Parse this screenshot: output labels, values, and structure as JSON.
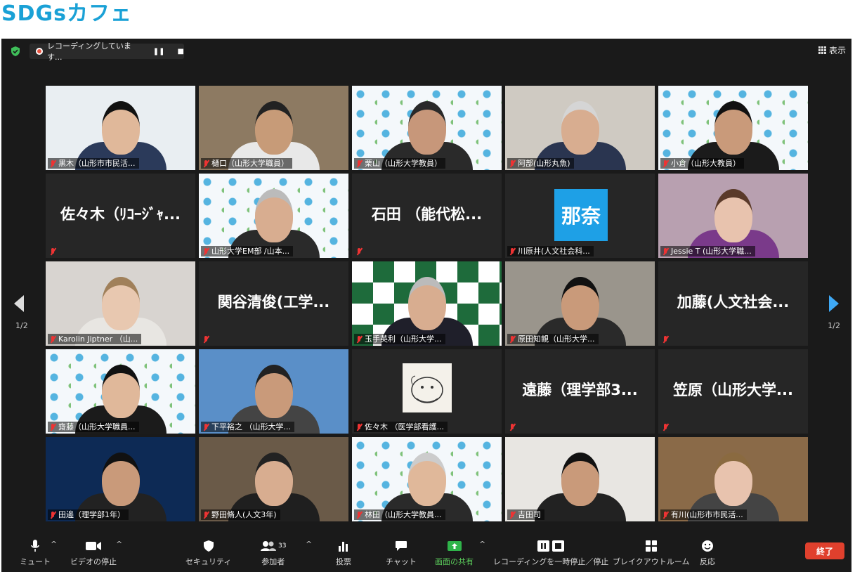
{
  "page": {
    "title": "SDGsカフェ"
  },
  "topbar": {
    "recording_text": "レコーディングしています...",
    "view_label": "表示"
  },
  "pagination": {
    "left": "1/2",
    "right": "1/2"
  },
  "participants": [
    {
      "label": "黒木（山形市市民活...",
      "video": true,
      "bg": "#e9eef2",
      "skin": "#e0b89a",
      "shirt": "#2b3a5a",
      "hair": "#111"
    },
    {
      "label": "樋口（山形大学職員）",
      "video": true,
      "bg": "#8d7a62",
      "skin": "#c79b78",
      "shirt": "#e8e8e8",
      "hair": "#222",
      "active": true
    },
    {
      "label": "栗山（山形大学教員）",
      "video": true,
      "pattern": "sdg",
      "skin": "#c7977a",
      "shirt": "#2a2a2a",
      "hair": "#2a2a2a"
    },
    {
      "label": "阿部(山形丸魚)",
      "video": true,
      "bg": "#cfcac2",
      "skin": "#d8ad90",
      "shirt": "#2a3550",
      "hair": "#d5d5d5"
    },
    {
      "label": "小倉（山形大教員）",
      "video": true,
      "pattern": "sdg",
      "skin": "#c99a7a",
      "shirt": "#1b1b1b",
      "hair": "#111"
    },
    {
      "label": "",
      "video": false,
      "name": "佐々木（ﾘｺｰｼﾞｬ..."
    },
    {
      "label": "山形大学EM部 /山本...",
      "video": true,
      "pattern": "sdg",
      "skin": "#d8ad90",
      "shirt": "#2a2a2a",
      "hair": "#bbb"
    },
    {
      "label": "",
      "video": false,
      "name": "石田 （能代松..."
    },
    {
      "label": "川原井(人文社会科...",
      "video": false,
      "avatar": "那奈"
    },
    {
      "label": "Jessie T (山形大学職...",
      "video": true,
      "bg": "#b8a0b0",
      "skin": "#e8c3ae",
      "shirt": "#7a3a8a",
      "hair": "#5a3a2a"
    },
    {
      "label": "Karolin Jiptner （山...",
      "video": true,
      "bg": "#d8d4d0",
      "skin": "#e8c8b0",
      "shirt": "#e8e6e2",
      "hair": "#a0805a"
    },
    {
      "label": "",
      "video": false,
      "name": "関谷清俊(工学..."
    },
    {
      "label": "玉手英利（山形大学...",
      "video": true,
      "pattern": "ymg",
      "skin": "#d8ad90",
      "shirt": "#1f1f2a",
      "hair": "#bbb"
    },
    {
      "label": "原田知親（山形大学...",
      "video": true,
      "bg": "#9a958c",
      "skin": "#c99a7a",
      "shirt": "#2a2a2a",
      "hair": "#111"
    },
    {
      "label": "",
      "video": false,
      "name": "加藤(人文社会..."
    },
    {
      "label": "齋藤（山形大学職員...",
      "video": true,
      "pattern": "sdg",
      "skin": "#e0b89a",
      "shirt": "#1b1b1b",
      "hair": "#111"
    },
    {
      "label": "下平裕之 （山形大学...",
      "video": true,
      "bg": "#5a8fc8",
      "skin": "#c99a7a",
      "shirt": "#444",
      "hair": "#222"
    },
    {
      "label": "佐々木 （医学部看護...",
      "video": false,
      "drawing": true
    },
    {
      "label": "",
      "video": false,
      "name": "遠藤（理学部3..."
    },
    {
      "label": "",
      "video": false,
      "name": "笠原（山形大学..."
    },
    {
      "label": "田邊（理学部1年）",
      "video": true,
      "bg": "#0d2a55",
      "skin": "#c99a7a",
      "shirt": "#222",
      "hair": "#111"
    },
    {
      "label": "野田脩人(人文3年)",
      "video": true,
      "bg": "#6a5a48",
      "skin": "#d8ad90",
      "shirt": "#1f1f1f",
      "hair": "#222"
    },
    {
      "label": "林田（山形大学教員...",
      "video": true,
      "pattern": "sdg",
      "skin": "#e0b89a",
      "shirt": "#2a2a2a",
      "hair": "#ccc"
    },
    {
      "label": "吉田司",
      "video": true,
      "bg": "#e8e6e2",
      "skin": "#c99a7a",
      "shirt": "#222",
      "hair": "#111"
    },
    {
      "label": "有川(山形市市民活...",
      "video": true,
      "bg": "#8a6a48",
      "skin": "#e8c3ae",
      "shirt": "#444",
      "hair": "#8a6a40"
    }
  ],
  "toolbar": {
    "mute": "ミュート",
    "video": "ビデオの停止",
    "security": "セキュリティ",
    "participants": "参加者",
    "participants_count": "33",
    "poll": "投票",
    "chat": "チャット",
    "share": "画面の共有",
    "record": "レコーディングを一時停止／停止",
    "breakout": "ブレイクアウトルーム",
    "reactions": "反応",
    "end": "終了"
  }
}
